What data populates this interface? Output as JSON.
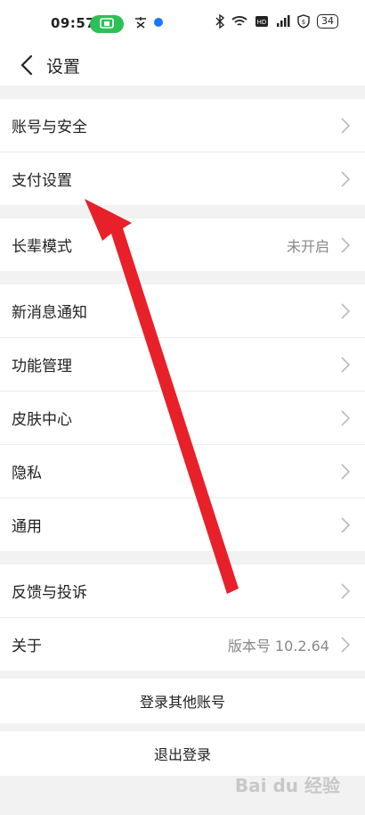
{
  "status_bar": {
    "time": "09:57",
    "battery": "34"
  },
  "header": {
    "title": "设置"
  },
  "groups": [
    {
      "items": [
        {
          "label": "账号与安全"
        },
        {
          "label": "支付设置"
        }
      ]
    },
    {
      "items": [
        {
          "label": "长辈模式",
          "value": "未开启"
        }
      ]
    },
    {
      "items": [
        {
          "label": "新消息通知"
        },
        {
          "label": "功能管理"
        },
        {
          "label": "皮肤中心"
        },
        {
          "label": "隐私"
        },
        {
          "label": "通用"
        }
      ]
    },
    {
      "items": [
        {
          "label": "反馈与投诉"
        },
        {
          "label": "关于",
          "value": "版本号 10.2.64"
        }
      ]
    }
  ],
  "buttons": {
    "switch_account": "登录其他账号",
    "logout": "退出登录"
  },
  "watermark": "Bai du 经验",
  "colors": {
    "arrow": "#e8202a",
    "pill": "#2fbf58"
  }
}
